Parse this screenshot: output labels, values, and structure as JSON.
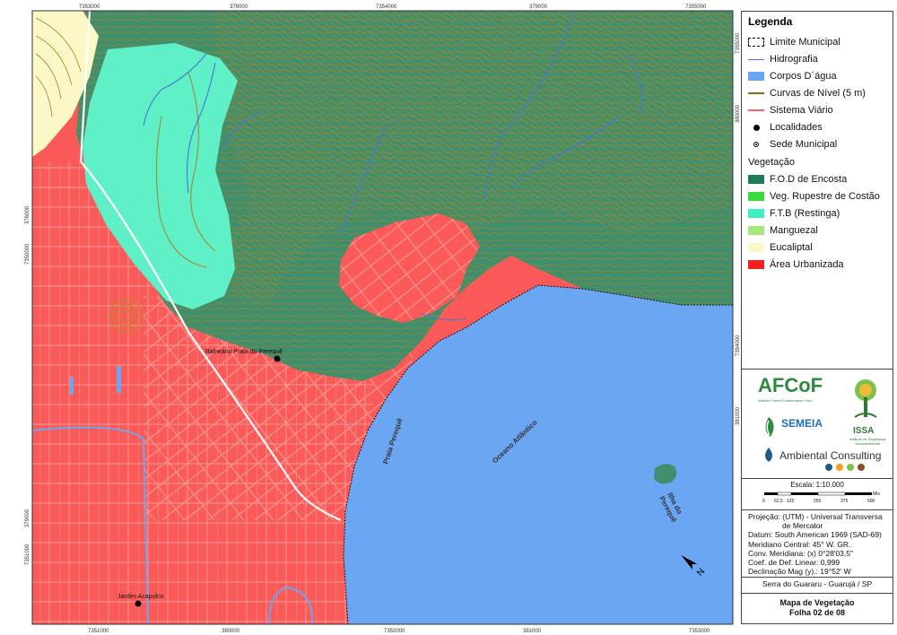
{
  "map": {
    "top_ticks": [
      "7353000",
      "378000",
      "7354000",
      "379000",
      "7355000"
    ],
    "bottom_ticks": [
      "7351000",
      "380000",
      "7352000",
      "381000",
      "7353000"
    ],
    "left_ticks": [
      "376000",
      "7350000",
      "379000",
      "7351000"
    ],
    "right_ticks": [
      "7355000",
      "380000",
      "7354000",
      "381000"
    ],
    "labels": {
      "balneario": "Balneário Praia do Perequê",
      "jardim": "Jardim Acapulco",
      "praia": "Praia Perequê",
      "oceano": "Oceano Atlântico",
      "ilha_line1": "Ilha do",
      "ilha_line2": "Perequê"
    },
    "colors": {
      "urban": "#fb5a58",
      "urban_road": "#f2908e",
      "forest": "#3f8f6f",
      "contour": "#a8821f",
      "restinga": "#5ff0c8",
      "water": "#6aa6f2",
      "river": "#4a74d6"
    }
  },
  "legend": {
    "title": "Legenda",
    "items": [
      {
        "label": "Limite Municipal",
        "symbol": "dashed-box"
      },
      {
        "label": "Hidrografia",
        "symbol": "blue-line"
      },
      {
        "label": "Corpos D´água",
        "symbol": "fill",
        "color": "#6aa6f2"
      },
      {
        "label": "Curvas de Nível (5 m)",
        "symbol": "brown-line"
      },
      {
        "label": "Sistema Viário",
        "symbol": "red-line"
      },
      {
        "label": "Localidades",
        "symbol": "dot"
      },
      {
        "label": "Sede Municipal",
        "symbol": "ring-dot"
      }
    ],
    "vegetation_title": "Vegetação",
    "vegetation": [
      {
        "label": "F.O.D de Encosta",
        "color": "#1f7a55"
      },
      {
        "label": "Veg. Rupestre de Costão",
        "color": "#3cd93c"
      },
      {
        "label": "F.T.B (Restinga)",
        "color": "#3fefc4"
      },
      {
        "label": "Manguezal",
        "color": "#a6e87c"
      },
      {
        "label": "Eucaliptal",
        "color": "#fbf7c6"
      },
      {
        "label": "Área Urbanizada",
        "color": "#ef2222"
      }
    ]
  },
  "logos": {
    "afcof": "AFCoF",
    "afcof_sub": "Atlantic Forest Conservation Fund",
    "semeia": "SEMEIA",
    "issa": "ISSA",
    "issa_sub": "Instituto de Segurança Socioambiental",
    "ambiental": "Ambiental Consulting"
  },
  "scale": {
    "label": "Escala: 1:10.000",
    "ticks": [
      "0",
      "62,5",
      "125",
      "250",
      "375",
      "500"
    ],
    "unit": "Mts"
  },
  "projection": [
    "Projeção: (UTM) - Universal Transversa",
    "de Mercator",
    "Datum: South American 1969 (SAD-69)",
    "Meridiano Central: 45° W. GR.",
    "Conv. Meridiana: (x) 0°28'03,5\"",
    "Coef. de Def. Linear: 0,999",
    "Declinação Mag (y).: 19°52' W"
  ],
  "location": "Serra do Guararu - Guarujá / SP",
  "sheet_title": "Mapa de Vegetação",
  "sheet_number": "Folha 02 de 08"
}
